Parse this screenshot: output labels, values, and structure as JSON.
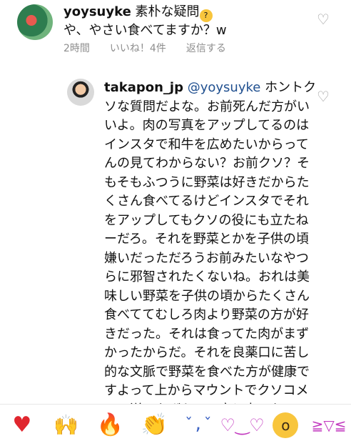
{
  "comment1": {
    "username": "yoysuyke",
    "text_line1": "素朴な疑問",
    "text_line2": "や、やさい食べてますか？w",
    "time": "2時間",
    "likes": "いいね！4件",
    "reply": "返信する",
    "emoji_icon": "thinking-face-icon"
  },
  "comment2": {
    "username": "takapon_jp",
    "mention": "@yoysuyke",
    "text": "ホントクソな質問だよな。お前死んだ方がいいよ。肉の写真をアップしてるのはインスタで和牛を広めたいからってんの見てわからない？お前クソ？そもそもふつうに野菜は好きだからたくさん食べてるけどインスタでそれをアップしてもクソの役にも立たねーだろ。それを野菜とかを子供の頃嫌いだっただろうお前みたいなやつらに邪智されたくないね。おれは美味しい野菜を子供の頃からたくさん食べててむしろ肉より野菜の方が好きだった。それは食ってた肉がまずかったからだ。それを良薬口に苦し的な文脈で野菜を食べた方が健康ですよって上からマウントでクソコメント送るなボケ。二度と来るな"
  },
  "reactions": [
    {
      "icon": "red-heart-icon",
      "glyph": "♥"
    },
    {
      "icon": "raised-hands-icon",
      "glyph": "🙌"
    },
    {
      "icon": "fire-icon",
      "glyph": "🔥"
    },
    {
      "icon": "clapping-hands-icon",
      "glyph": "👏"
    },
    {
      "icon": "crying-face-icon",
      "glyph": "ˇ_ˇ"
    },
    {
      "icon": "heart-eyes-icon",
      "glyph": "♡‿♡"
    },
    {
      "icon": "surprised-face-icon",
      "glyph": "o"
    },
    {
      "icon": "laughing-face-icon",
      "glyph": "≧▽≦"
    }
  ]
}
